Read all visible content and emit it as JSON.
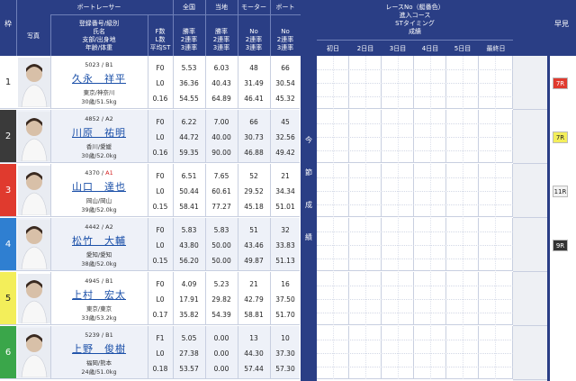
{
  "header": {
    "waku": "枠",
    "photo": "写真",
    "boat_racer": "ボートレーサー",
    "racer_info": [
      "登録番号/級別",
      "氏名",
      "支部/出身地",
      "年齢/体重"
    ],
    "fl": [
      "F数",
      "L数",
      "平均ST"
    ],
    "national": "全国",
    "local": "当地",
    "motor": "モーター",
    "boat": "ボート",
    "rate_national": [
      "勝率",
      "2連率",
      "3連率"
    ],
    "rate_local": [
      "勝率",
      "2連率",
      "3連率"
    ],
    "rate_motor": [
      "No",
      "2連率",
      "3連率"
    ],
    "rate_boat": [
      "No",
      "2連率",
      "3連率"
    ],
    "race_info": [
      "レースNo（艇番色）",
      "進入コース",
      "STタイミング",
      "成績"
    ],
    "days": [
      "初日",
      "2日目",
      "3日目",
      "4日目",
      "5日目",
      "最終日"
    ],
    "early": "早見",
    "konsetsu": [
      "今",
      "節",
      "成",
      "績"
    ]
  },
  "racers": [
    {
      "frame": "1",
      "frame_color": "#ffffff",
      "frame_text_color": "#222222",
      "reg": "5023",
      "grade": "B1",
      "grade_color": "#333333",
      "name": "久永　祥平",
      "branch": "東京/神奈川",
      "age_weight": "30歳/51.5kg",
      "f": "F0",
      "l": "L0",
      "st": "0.16",
      "nat": [
        "5.53",
        "36.36",
        "54.55"
      ],
      "loc": [
        "6.03",
        "40.43",
        "64.89"
      ],
      "motor": [
        "48",
        "31.49",
        "46.41"
      ],
      "boat": [
        "66",
        "30.54",
        "45.32"
      ],
      "early": "7R",
      "early_bg": "#e03a2e",
      "early_color": "#ffffff"
    },
    {
      "frame": "2",
      "frame_color": "#3a3a3a",
      "frame_text_color": "#ffffff",
      "reg": "4852",
      "grade": "A2",
      "grade_color": "#333333",
      "name": "川原　祐明",
      "branch": "香川/愛媛",
      "age_weight": "30歳/52.0kg",
      "f": "F0",
      "l": "L0",
      "st": "0.16",
      "nat": [
        "6.22",
        "44.72",
        "59.35"
      ],
      "loc": [
        "7.00",
        "40.00",
        "90.00"
      ],
      "motor": [
        "66",
        "30.73",
        "46.88"
      ],
      "boat": [
        "45",
        "32.56",
        "49.42"
      ],
      "early": "7R",
      "early_bg": "#f3ee5a",
      "early_color": "#222222"
    },
    {
      "frame": "3",
      "frame_color": "#e03a2e",
      "frame_text_color": "#ffffff",
      "reg": "4370",
      "grade": "A1",
      "grade_color": "#d42020",
      "name": "山口　達也",
      "branch": "岡山/岡山",
      "age_weight": "39歳/52.0kg",
      "f": "F0",
      "l": "L0",
      "st": "0.15",
      "nat": [
        "6.51",
        "50.44",
        "58.41"
      ],
      "loc": [
        "7.65",
        "60.61",
        "77.27"
      ],
      "motor": [
        "52",
        "29.52",
        "45.18"
      ],
      "boat": [
        "21",
        "34.34",
        "51.01"
      ],
      "early": "11R",
      "early_bg": "#f2f2f2",
      "early_color": "#222222"
    },
    {
      "frame": "4",
      "frame_color": "#2f7fd1",
      "frame_text_color": "#ffffff",
      "reg": "4442",
      "grade": "A2",
      "grade_color": "#333333",
      "name": "松竹　大輔",
      "branch": "愛知/愛知",
      "age_weight": "38歳/52.0kg",
      "f": "F0",
      "l": "L0",
      "st": "0.15",
      "nat": [
        "5.83",
        "43.80",
        "56.20"
      ],
      "loc": [
        "5.83",
        "50.00",
        "50.00"
      ],
      "motor": [
        "51",
        "43.46",
        "49.87"
      ],
      "boat": [
        "32",
        "33.83",
        "51.13"
      ],
      "early": "9R",
      "early_bg": "#333333",
      "early_color": "#ffffff"
    },
    {
      "frame": "5",
      "frame_color": "#f3ee5a",
      "frame_text_color": "#222222",
      "reg": "4945",
      "grade": "B1",
      "grade_color": "#333333",
      "name": "上村　宏太",
      "branch": "東京/東京",
      "age_weight": "33歳/53.2kg",
      "f": "F0",
      "l": "L0",
      "st": "0.17",
      "nat": [
        "4.09",
        "17.91",
        "35.82"
      ],
      "loc": [
        "5.23",
        "29.82",
        "54.39"
      ],
      "motor": [
        "21",
        "42.79",
        "58.81"
      ],
      "boat": [
        "16",
        "37.50",
        "51.70"
      ],
      "early": "",
      "early_bg": "",
      "early_color": ""
    },
    {
      "frame": "6",
      "frame_color": "#3aa64a",
      "frame_text_color": "#ffffff",
      "reg": "5239",
      "grade": "B1",
      "grade_color": "#333333",
      "name": "上野　俊樹",
      "branch": "福岡/熊本",
      "age_weight": "24歳/51.0kg",
      "f": "F1",
      "l": "L0",
      "st": "0.18",
      "nat": [
        "5.05",
        "27.38",
        "53.57"
      ],
      "loc": [
        "0.00",
        "0.00",
        "0.00"
      ],
      "motor": [
        "13",
        "44.30",
        "57.44"
      ],
      "boat": [
        "10",
        "37.30",
        "57.30"
      ],
      "early": "",
      "early_bg": "",
      "early_color": ""
    }
  ]
}
